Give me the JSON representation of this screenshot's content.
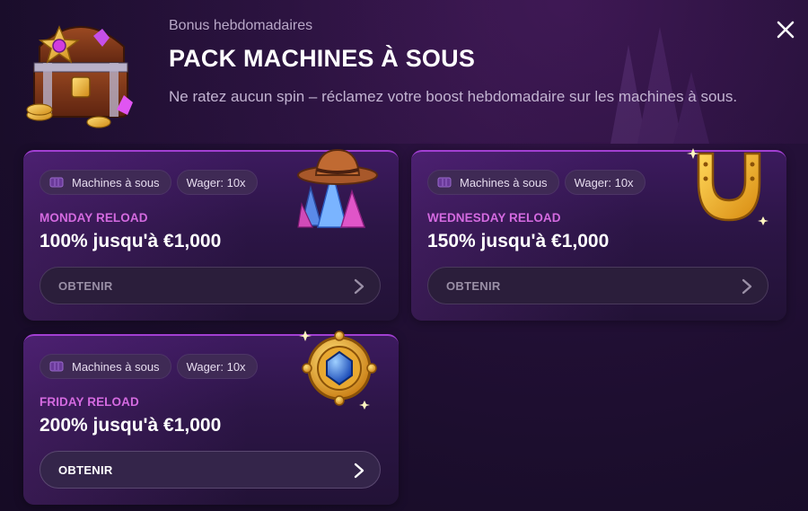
{
  "header": {
    "subtitle": "Bonus hebdomadaires",
    "title": "PACK MACHINES À SOUS",
    "description": "Ne ratez aucun spin – réclamez votre boost hebdomadaire sur les machines à sous.",
    "icon": "treasure-chest-icon",
    "close_icon": "close-icon"
  },
  "cards": [
    {
      "tag_category": "Machines à sous",
      "tag_wager": "Wager: 10x",
      "label": "MONDAY RELOAD",
      "amount": "100% jusqu'à €1,000",
      "button": "OBTENIR",
      "button_state": "dim",
      "illustration": "cowboy-hat-crystals-icon"
    },
    {
      "tag_category": "Machines à sous",
      "tag_wager": "Wager: 10x",
      "label": "WEDNESDAY RELOAD",
      "amount": "150% jusqu'à €1,000",
      "button": "OBTENIR",
      "button_state": "dim",
      "illustration": "golden-horseshoe-icon"
    },
    {
      "tag_category": "Machines à sous",
      "tag_wager": "Wager: 10x",
      "label": "FRIDAY RELOAD",
      "amount": "200% jusqu'à €1,000",
      "button": "OBTENIR",
      "button_state": "active",
      "illustration": "gold-sapphire-amulet-icon"
    }
  ],
  "colors": {
    "accent_label": "#d46ae0",
    "card_border": "#a23fd2",
    "background": "#1a0d2b"
  }
}
